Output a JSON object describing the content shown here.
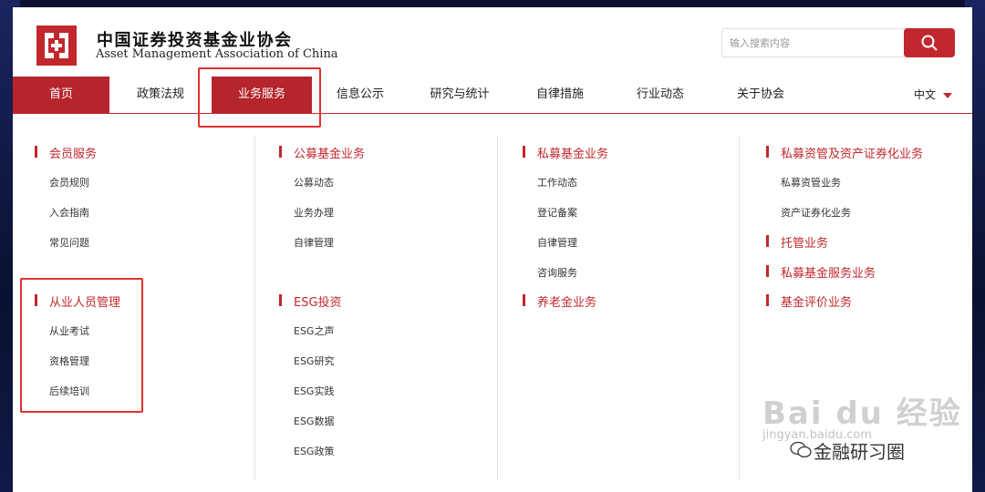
{
  "header": {
    "org_name_cn": "中国证券投资基金业协会",
    "org_name_en": "Asset Management Association of China"
  },
  "search": {
    "placeholder": "输入搜索内容"
  },
  "nav": {
    "items": [
      "首页",
      "政策法规",
      "业务服务",
      "信息公示",
      "研究与统计",
      "自律措施",
      "行业动态",
      "关于协会"
    ],
    "language": "中文",
    "active": "业务服务"
  },
  "menu": {
    "col1": {
      "sec1": {
        "title": "会员服务",
        "items": [
          "会员规则",
          "入会指南",
          "常见问题"
        ]
      },
      "sec2": {
        "title": "从业人员管理",
        "items": [
          "从业考试",
          "资格管理",
          "后续培训"
        ]
      }
    },
    "col2": {
      "sec1": {
        "title": "公募基金业务",
        "items": [
          "公募动态",
          "业务办理",
          "自律管理"
        ]
      },
      "sec2": {
        "title": "ESG投资",
        "items": [
          "ESG之声",
          "ESG研究",
          "ESG实践",
          "ESG数据",
          "ESG政策"
        ]
      }
    },
    "col3": {
      "sec1": {
        "title": "私募基金业务",
        "items": [
          "工作动态",
          "登记备案",
          "自律管理",
          "咨询服务"
        ]
      },
      "sec2": {
        "title": "养老金业务"
      }
    },
    "col4": {
      "sec1": {
        "title": "私募资管及资产证券化业务",
        "items": [
          "私募资管业务",
          "资产证券化业务"
        ]
      },
      "sec2": {
        "title": "托管业务"
      },
      "sec3": {
        "title": "私募基金服务业务"
      },
      "sec4": {
        "title": "基金评价业务"
      }
    }
  },
  "watermark": {
    "text": "Bai du 经验",
    "sub": "jingyan.baidu.com",
    "overlay": "金融研习圈"
  },
  "colors": {
    "brand_red": "#c1272d",
    "highlight_red": "#e0302c"
  }
}
